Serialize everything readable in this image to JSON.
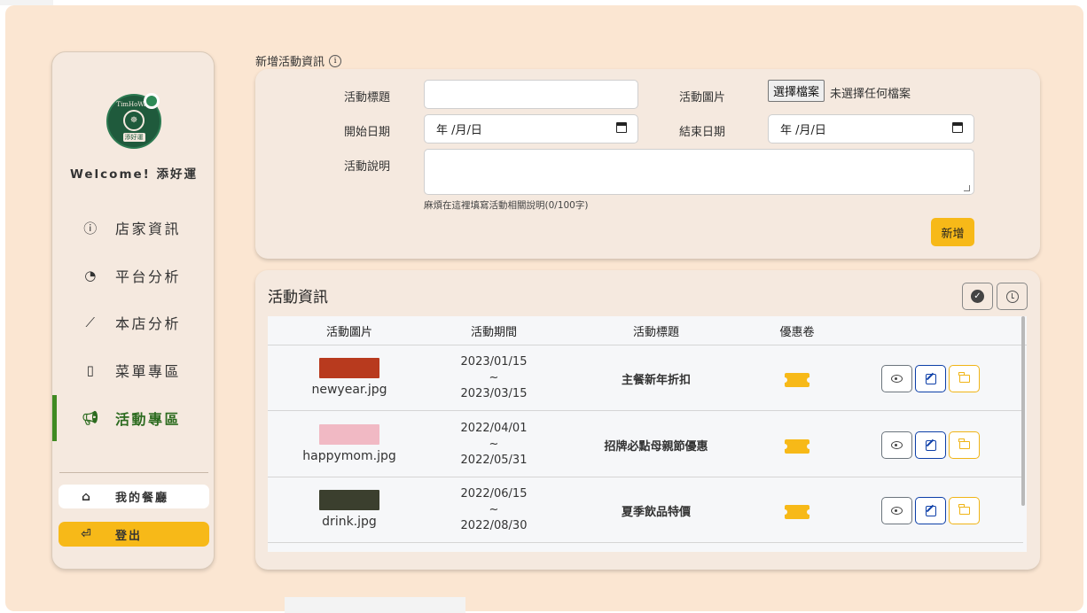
{
  "sidebar": {
    "logo_text_top": "TimHoWan",
    "logo_text_mid": "添好運",
    "logo_text_bottom": "添好運",
    "welcome": "Welcome! 添好運",
    "nav": [
      {
        "label": "店家資訊",
        "icon": "info-circle-icon"
      },
      {
        "label": "平台分析",
        "icon": "pie-chart-icon"
      },
      {
        "label": "本店分析",
        "icon": "line-chart-icon"
      },
      {
        "label": "菜單專區",
        "icon": "clipboard-icon"
      },
      {
        "label": "活動專區",
        "icon": "megaphone-icon",
        "active": true
      }
    ],
    "my_restaurant": "我的餐廳",
    "logout": "登出",
    "accent_color": "#3f8a22",
    "logout_color": "#f7b918"
  },
  "form": {
    "section_title": "新增活動資訊",
    "title_label": "活動標題",
    "title_value": "",
    "image_label": "活動圖片",
    "file_button": "選擇檔案",
    "file_status": "未選擇任何檔案",
    "start_label": "開始日期",
    "start_value": "年 /月/日",
    "end_label": "結束日期",
    "end_value": "年 /月/日",
    "desc_label": "活動說明",
    "desc_value": "",
    "hint": "麻煩在這裡填寫活動相關說明(0/100字)",
    "submit": "新增"
  },
  "list": {
    "title": "活動資訊",
    "columns": [
      "活動圖片",
      "活動期間",
      "活動標題",
      "優惠卷"
    ],
    "rows": [
      {
        "image": "newyear.jpg",
        "start": "2023/01/15",
        "sep": "~",
        "end": "2023/03/15",
        "title": "主餐新年折扣",
        "thumb_color": "#b83a1e"
      },
      {
        "image": "happymom.jpg",
        "start": "2022/04/01",
        "sep": "~",
        "end": "2022/05/31",
        "title": "招牌必點母親節優惠",
        "thumb_color": "#f1b9c4"
      },
      {
        "image": "drink.jpg",
        "start": "2022/06/15",
        "sep": "~",
        "end": "2022/08/30",
        "title": "夏季飲品特價",
        "thumb_color": "#3b3f2e"
      }
    ]
  }
}
